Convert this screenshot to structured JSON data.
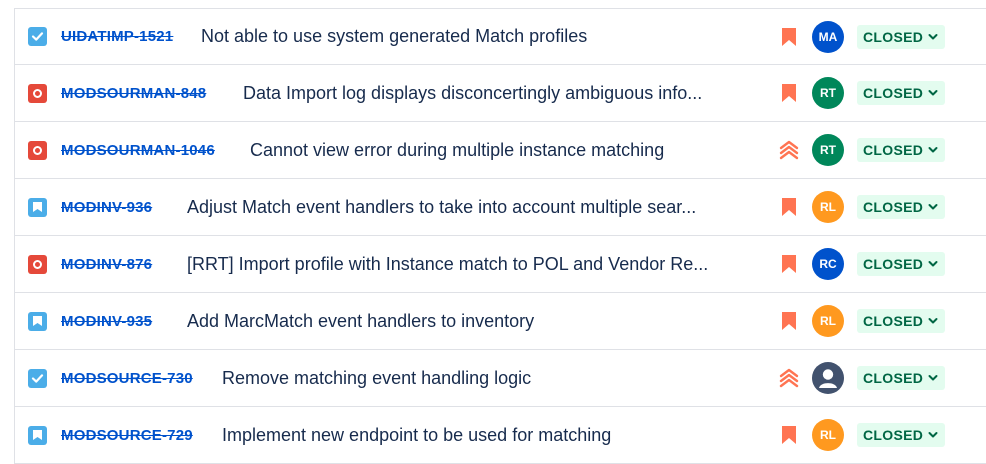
{
  "issues": [
    {
      "type": "task",
      "type_icon": "checkbox-icon",
      "key": "UIDATIMP-1521",
      "summary": "Not able to use system generated Match profiles",
      "priority_icon": "priority-medium-icon",
      "assignee": "MA",
      "avatar_color": "#0052cc",
      "status": "CLOSED"
    },
    {
      "type": "bug",
      "type_icon": "bug-icon",
      "key": "MODSOURMAN-848",
      "summary": "Data Import log displays disconcertingly ambiguous info...",
      "priority_icon": "priority-medium-icon",
      "assignee": "RT",
      "avatar_color": "#00875a",
      "status": "CLOSED"
    },
    {
      "type": "bug",
      "type_icon": "bug-icon",
      "key": "MODSOURMAN-1046",
      "summary": "Cannot view error during multiple instance matching",
      "priority_icon": "priority-highest-icon",
      "assignee": "RT",
      "avatar_color": "#00875a",
      "status": "CLOSED"
    },
    {
      "type": "story",
      "type_icon": "story-icon",
      "key": "MODINV-936",
      "summary": "Adjust Match event handlers to take into account multiple sear...",
      "priority_icon": "priority-medium-icon",
      "assignee": "RL",
      "avatar_color": "#ff991f",
      "status": "CLOSED"
    },
    {
      "type": "bug",
      "type_icon": "bug-icon",
      "key": "MODINV-876",
      "summary": "[RRT] Import profile with Instance match to POL and Vendor Re...",
      "priority_icon": "priority-medium-icon",
      "assignee": "RC",
      "avatar_color": "#0052cc",
      "status": "CLOSED"
    },
    {
      "type": "story",
      "type_icon": "story-icon",
      "key": "MODINV-935",
      "summary": "Add MarcMatch event handlers to inventory",
      "priority_icon": "priority-medium-icon",
      "assignee": "RL",
      "avatar_color": "#ff991f",
      "status": "CLOSED"
    },
    {
      "type": "task",
      "type_icon": "checkbox-icon",
      "key": "MODSOURCE-730",
      "summary": "Remove matching event handling logic",
      "priority_icon": "priority-highest-icon",
      "assignee": "",
      "avatar_color": "#42526e",
      "status": "CLOSED"
    },
    {
      "type": "story",
      "type_icon": "story-icon",
      "key": "MODSOURCE-729",
      "summary": "Implement new endpoint to be used for matching",
      "priority_icon": "priority-medium-icon",
      "assignee": "RL",
      "avatar_color": "#ff991f",
      "status": "CLOSED"
    }
  ]
}
